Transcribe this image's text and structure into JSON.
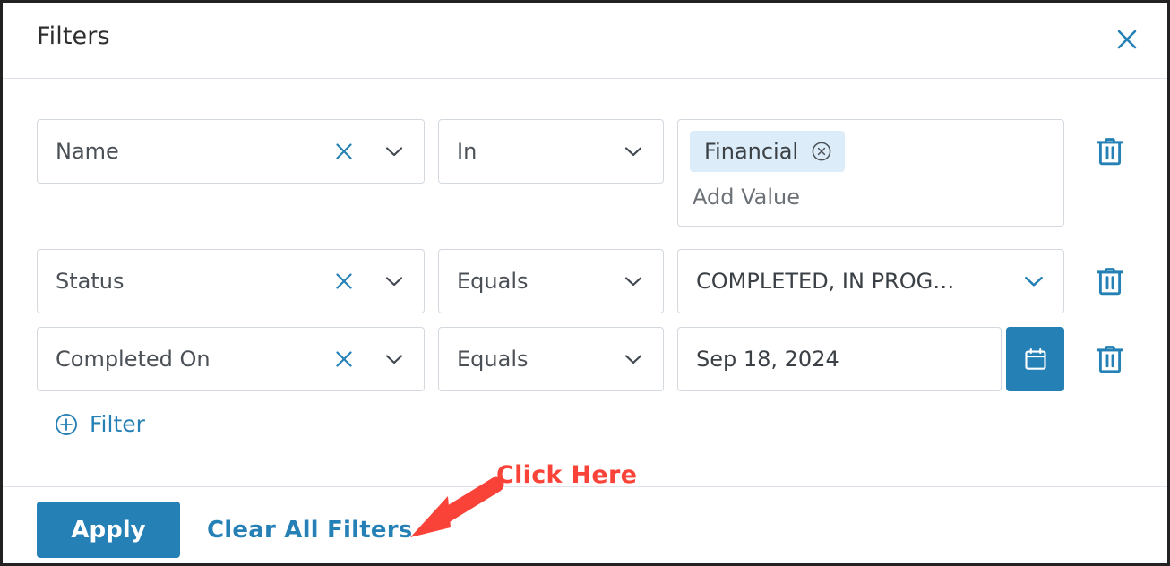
{
  "dialog": {
    "title": "Filters",
    "close_icon": "close-icon"
  },
  "filters": [
    {
      "attribute": "Name",
      "attribute_clear_icon": "clear-icon",
      "attribute_chevron_icon": "chevron-down-icon",
      "operator": "In",
      "operator_chevron_icon": "chevron-down-icon",
      "value_type": "multi-chip",
      "chips": [
        {
          "label": "Financial",
          "remove_icon": "circle-close-icon"
        }
      ],
      "value_placeholder": "Add Value",
      "delete_icon": "trash-icon"
    },
    {
      "attribute": "Status",
      "attribute_clear_icon": "clear-icon",
      "attribute_chevron_icon": "chevron-down-icon",
      "operator": "Equals",
      "operator_chevron_icon": "chevron-down-icon",
      "value_type": "select",
      "value": "COMPLETED, IN PROG…",
      "value_chevron_icon": "chevron-down-icon",
      "delete_icon": "trash-icon"
    },
    {
      "attribute": "Completed On",
      "attribute_clear_icon": "clear-icon",
      "attribute_chevron_icon": "chevron-down-icon",
      "operator": "Equals",
      "operator_chevron_icon": "chevron-down-icon",
      "value_type": "date",
      "value": "Sep 18, 2024",
      "calendar_icon": "calendar-icon",
      "delete_icon": "trash-icon"
    }
  ],
  "add_filter": {
    "label": "Filter",
    "icon": "circle-plus-icon"
  },
  "footer": {
    "apply_label": "Apply",
    "clear_all_label": "Clear All Filters"
  },
  "annotation": {
    "text": "Click Here",
    "color": "#fa4338",
    "arrow_icon": "arrow-down-left-icon"
  },
  "colors": {
    "accent": "#2580b5",
    "chip_background": "#dcecf8",
    "border": "#d3d9de",
    "divider": "#dde3e9",
    "text": "#4a5056",
    "annotation": "#fa4338"
  }
}
